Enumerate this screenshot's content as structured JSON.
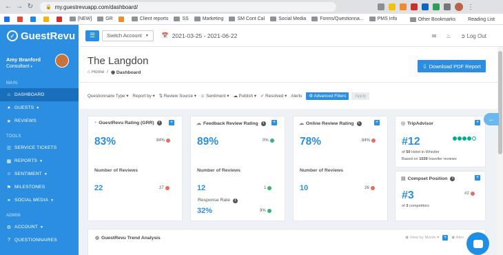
{
  "browser": {
    "url": "my.guestrevuapp.com/dashboard/",
    "bookmarks": [
      "[NEW]",
      "GR",
      "Client reports",
      "SS",
      "Marketing",
      "SM Cont Cal",
      "Social Media",
      "Forms/Questionna...",
      "PMS Info"
    ],
    "bookmark_right": [
      "Other Bookmarks",
      "Reading List"
    ]
  },
  "sidebar": {
    "logo": "GuestRevu",
    "user_name": "Amy Branford",
    "user_role": "Consultant",
    "sections": [
      {
        "label": "MAIN",
        "items": [
          {
            "label": "DASHBOARD",
            "icon": "home-icon",
            "active": true
          },
          {
            "label": "GUESTS",
            "icon": "users-icon",
            "caret": true
          },
          {
            "label": "REVIEWS",
            "icon": "reviews-icon"
          }
        ]
      },
      {
        "label": "TOOLS",
        "items": [
          {
            "label": "SERVICE TICKETS",
            "icon": "ticket-icon"
          },
          {
            "label": "REPORTS",
            "icon": "reports-icon",
            "caret": true
          },
          {
            "label": "SENTIMENT",
            "icon": "sentiment-icon",
            "caret": true
          },
          {
            "label": "MILESTONES",
            "icon": "milestone-icon"
          },
          {
            "label": "SOCIAL MEDIA",
            "icon": "social-icon",
            "caret": true
          }
        ]
      },
      {
        "label": "ADMIN",
        "items": [
          {
            "label": "ACCOUNT",
            "icon": "account-icon",
            "caret": true
          },
          {
            "label": "QUESTIONNAIRES",
            "icon": "questionnaire-icon"
          }
        ]
      }
    ]
  },
  "topbar": {
    "switch_label": "Switch Account",
    "date_range": "2021-03-25 - 2021-06-22",
    "logout": "Log Out"
  },
  "page": {
    "title": "The Langdon",
    "crumb_home": "Home",
    "crumb_current": "Dashboard",
    "pdf_button": "Download PDF Report"
  },
  "filters": [
    "Questionnaire Type",
    "Report by",
    "Review Source",
    "Sentiment",
    "Publish",
    "Resolved",
    "Alerts"
  ],
  "advanced_filters": "Advanced Filters",
  "apply_label": "Apply",
  "cards": {
    "grr": {
      "title": "GuestRevu Rating (GRR)",
      "value": "83%",
      "prev": "84%",
      "reviews_label": "Number of Reviews",
      "reviews": "22",
      "reviews_prev": "27"
    },
    "frr": {
      "title": "Feedback Review Rating",
      "value": "89%",
      "prev": "0%",
      "reviews_label": "Number of Reviews",
      "reviews": "12",
      "reviews_prev": "1",
      "response_label": "Response Rate",
      "response": "32%",
      "response_prev": "9%"
    },
    "orr": {
      "title": "Online Review Rating",
      "value": "78%",
      "prev": "84%",
      "reviews_label": "Number of Reviews",
      "reviews": "10",
      "reviews_prev": "26"
    },
    "tripadvisor": {
      "title": "TripAdvisor",
      "rank": "#12",
      "of_prefix": "of",
      "total": "50",
      "rank_desc": "Hotel in Whistler",
      "based_prefix": "Based on",
      "count": "1039",
      "based_suffix": "traveller reviews",
      "rating_bubbles": 4
    },
    "compset": {
      "title": "Compset Position",
      "position": "#3",
      "prev": "#2",
      "of_prefix": "of",
      "total": "3",
      "suffix": "competitors"
    }
  },
  "trend": {
    "title": "GuestRevu Trend Analysis",
    "view_by": "View by Month",
    "filter": "Alter"
  },
  "colors": {
    "brand": "#2b8ee0",
    "sidebar_active": "#1a6fbd",
    "delta_down": "#e86c60",
    "delta_up": "#3cb371"
  }
}
